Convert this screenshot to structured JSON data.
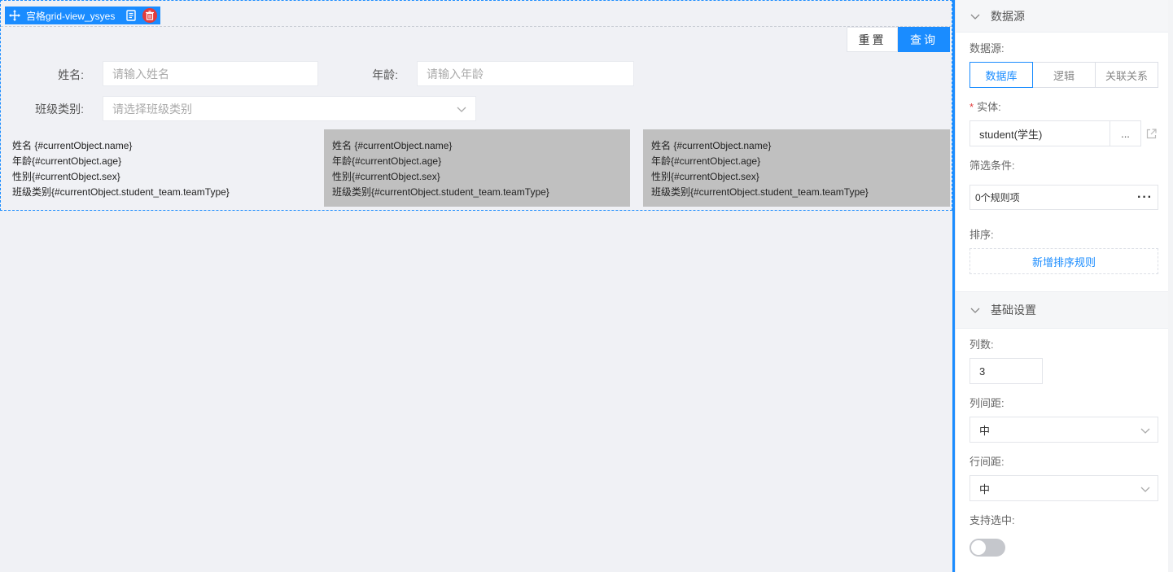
{
  "canvas": {
    "component_tag": "宫格grid-view_ysyes",
    "reset_label": "重置",
    "query_label": "查询",
    "filters": {
      "name_label": "姓名:",
      "name_placeholder": "请输入姓名",
      "age_label": "年龄:",
      "age_placeholder": "请输入年龄",
      "class_label": "班级类别:",
      "class_placeholder": "请选择班级类别"
    },
    "cards": [
      [
        "姓名 {#currentObject.name}",
        "年龄{#currentObject.age}",
        "性别{#currentObject.sex}",
        "班级类别{#currentObject.student_team.teamType}"
      ],
      [
        "姓名 {#currentObject.name}",
        "年龄{#currentObject.age}",
        "性别{#currentObject.sex}",
        "班级类别{#currentObject.student_team.teamType}"
      ],
      [
        "姓名 {#currentObject.name}",
        "年龄{#currentObject.age}",
        "性别{#currentObject.sex}",
        "班级类别{#currentObject.student_team.teamType}"
      ]
    ]
  },
  "panel": {
    "datasource_section": "数据源",
    "datasource_label": "数据源:",
    "datasource_tabs": [
      "数据库",
      "逻辑",
      "关联关系"
    ],
    "datasource_active": "数据库",
    "entity_required_mark": "*",
    "entity_label": "实体:",
    "entity_value": "student(学生)",
    "entity_more": "...",
    "filter_label": "筛选条件:",
    "filter_value": "0个规则项",
    "filter_more": "···",
    "sort_label": "排序:",
    "add_sort_label": "新增排序规则",
    "basic_section": "基础设置",
    "cols_label": "列数:",
    "cols_value": "3",
    "col_gap_label": "列间距:",
    "col_gap_value": "中",
    "row_gap_label": "行间距:",
    "row_gap_value": "中",
    "selectable_label": "支持选中:",
    "selectable_on": false
  },
  "colors": {
    "accent": "#1a8cff",
    "delete": "#e23b3b",
    "card_gray": "#c0c0c0"
  }
}
